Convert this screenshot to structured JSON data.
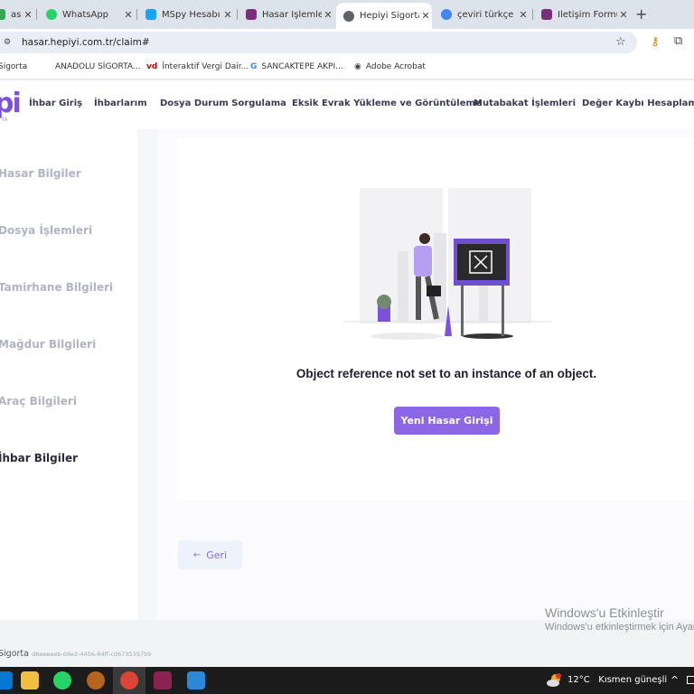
{
  "browser": {
    "tabs": [
      {
        "label": "asu",
        "icon": "sheet-icon",
        "color": "#34a853"
      },
      {
        "label": "WhatsApp",
        "icon": "whatsapp-icon",
        "color": "#25d366"
      },
      {
        "label": "MSpy Hesabı",
        "icon": "mspy-icon",
        "color": "#1da1f2"
      },
      {
        "label": "Hasar İşlemleri",
        "icon": "hepiyi-icon",
        "color": "#7b2f7b"
      },
      {
        "label": "Hepiyi Sigorta",
        "icon": "globe-icon",
        "color": "#5f6368"
      },
      {
        "label": "çeviri türkçe",
        "icon": "google-icon",
        "color": "#4285f4"
      },
      {
        "label": "İletişim Formu",
        "icon": "hepiyi-icon",
        "color": "#7b2f7b"
      }
    ],
    "close_glyph": "✕",
    "newtab_glyph": "+",
    "url": "hasar.hepiyi.com.tr/claim#"
  },
  "bookmarks": [
    {
      "label": "Sigorta",
      "icon": ""
    },
    {
      "label": "ANADOLU SİGORTA...",
      "icon": ""
    },
    {
      "label": "İnteraktif Vergi Dair...",
      "icon": "vd"
    },
    {
      "label": "SANCAKTEPE AKPI...",
      "icon": "G"
    },
    {
      "label": "Adobe Acrobat",
      "icon": "globe"
    }
  ],
  "site": {
    "logo": "pi",
    "logo_sub": "TA",
    "nav": [
      "İhbar Giriş",
      "İhbarlarım",
      "Dosya Durum Sorgulama",
      "Eksik Evrak Yükleme ve Görüntüleme",
      "Mutabakat İşlemleri",
      "Değer Kaybı Hesaplama"
    ],
    "brand_color": "#7b52d9"
  },
  "sidebar": {
    "items": [
      {
        "label": "Hasar Bilgiler"
      },
      {
        "label": "Dosya İşlemleri"
      },
      {
        "label": "Tamirhane Bilgileri"
      },
      {
        "label": "Mağdur Bilgileri"
      },
      {
        "label": "Araç Bilgileri"
      },
      {
        "label": "İhbar Bilgiler"
      }
    ]
  },
  "main": {
    "error_message": "Object reference not set to an instance of an object.",
    "new_claim_label": "Yeni Hasar Girişi",
    "back_label": "Geri",
    "back_arrow": "←"
  },
  "footer": {
    "brand": "Sigorta",
    "build_id": "d8eeeeeb-66e2-4456-84ff-cd6735357b9"
  },
  "watermark": {
    "line1": "Windows'u Etkinleştir",
    "line2": "Windows'u etkinleştirmek için Ayarl"
  },
  "taskbar": {
    "temperature": "12°C",
    "weather": "Kısmen güneşli",
    "weather_badge": "1",
    "chevron": "^"
  }
}
